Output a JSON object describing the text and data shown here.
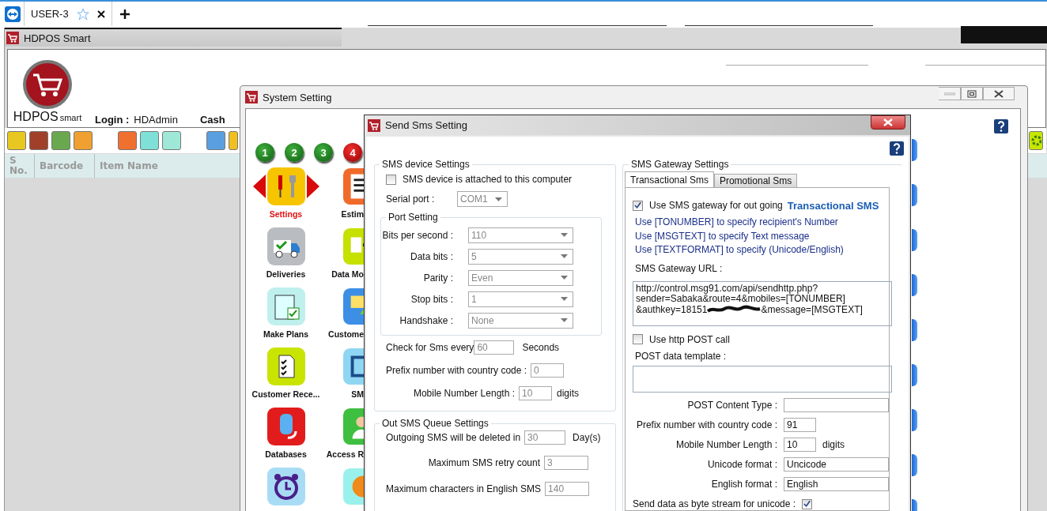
{
  "browser_tab": {
    "label": "USER-3"
  },
  "main_window": {
    "title": "HDPOS Smart",
    "logo_text": "HDPOS",
    "logo_subtext": "smart",
    "login_label": "Login :",
    "login_value": "HDAdmin",
    "cash_label": "Cash",
    "table_columns": [
      "S No.",
      "Barcode",
      "Item Name"
    ]
  },
  "system_setting": {
    "title": "System Setting",
    "pages": [
      {
        "label": "1",
        "selected": false
      },
      {
        "label": "2",
        "selected": false
      },
      {
        "label": "3",
        "selected": false
      },
      {
        "label": "4",
        "selected": true
      }
    ],
    "tiles": [
      {
        "label": "Settings",
        "selected": true
      },
      {
        "label": "Estim",
        "selected": false
      },
      {
        "label": "Deliveries",
        "selected": false
      },
      {
        "label": "Data Mo",
        "selected": false
      },
      {
        "label": "Make Plans",
        "selected": false
      },
      {
        "label": "Custome",
        "selected": false
      },
      {
        "label": "Customer Rece...",
        "selected": false
      },
      {
        "label": "SM",
        "selected": false
      },
      {
        "label": "Databases",
        "selected": false
      },
      {
        "label": "Access R",
        "selected": false
      },
      {
        "selected": false
      },
      {
        "selected": false
      }
    ]
  },
  "sms_dialog": {
    "title": "Send Sms Setting",
    "device": {
      "legend": "SMS device Settings",
      "attached": {
        "label": "SMS device is attached to this computer",
        "checked": false
      },
      "serial_port": {
        "label": "Serial port :",
        "value": "COM1",
        "disabled": true
      },
      "port_setting": {
        "legend": "Port Setting",
        "fields": [
          {
            "label": "Bits per second :",
            "value": "110",
            "disabled": true
          },
          {
            "label": "Data bits :",
            "value": "5",
            "disabled": true
          },
          {
            "label": "Parity :",
            "value": "Even",
            "disabled": true
          },
          {
            "label": "Stop bits :",
            "value": "1",
            "disabled": true
          },
          {
            "label": "Handshake :",
            "value": "None",
            "disabled": true
          }
        ]
      },
      "check_every": {
        "label": "Check for Sms every",
        "value": "60",
        "unit": "Seconds",
        "disabled": true
      },
      "prefix": {
        "label": "Prefix number with country code :",
        "value": "0",
        "disabled": true
      },
      "mobile_length": {
        "label": "Mobile Number Length :",
        "value": "10",
        "unit": "digits",
        "disabled": true
      }
    },
    "queue": {
      "legend": "Out SMS Queue Settings",
      "fields": [
        {
          "label": "Outgoing SMS will be deleted in",
          "value": "30",
          "unit": "Day(s)",
          "disabled": true
        },
        {
          "label": "Maximum SMS retry count",
          "value": "3",
          "disabled": true
        },
        {
          "label": "Maximum characters in English SMS",
          "value": "140",
          "disabled": true
        }
      ]
    },
    "gateway": {
      "legend": "SMS Gateway Settings",
      "tabs": [
        {
          "label": "Transactional Sms",
          "selected": true
        },
        {
          "label": "Promotional Sms",
          "selected": false
        }
      ],
      "use_gateway": {
        "label": "Use SMS gateway for out going",
        "emphasis": "Transactional SMS",
        "checked": true
      },
      "hints": [
        "Use [TONUMBER] to specify recipient's Number",
        "Use [MSGTEXT] to specify Text message",
        "Use [TEXTFORMAT] to specify (Unicode/English)"
      ],
      "url_label": "SMS Gateway URL :",
      "url_lines": [
        "http://control.msg91.com/api/sendhttp.php?",
        "sender=Sabaka&route=4&mobiles=[TONUMBER]",
        "&authkey=18151"
      ],
      "url_tail": "&message=[MSGTEXT]",
      "http_post": {
        "label": "Use http POST call",
        "checked": false
      },
      "post_template_label": "POST data template :",
      "fields": [
        {
          "kind": "wide",
          "label": "POST Content Type :"
        },
        {
          "kind": "short",
          "label": "Prefix number with country code :",
          "value": "91"
        },
        {
          "kind": "short",
          "label": "Mobile Number Length :",
          "value": "10",
          "unit": "digits"
        },
        {
          "kind": "wide",
          "label": "Unicode format :",
          "value": "Uncicode"
        },
        {
          "kind": "wide",
          "label": "English format :",
          "value": "English"
        },
        {
          "kind": "checkbox",
          "label": "Send data as byte stream for unicode :",
          "checked": true
        }
      ]
    }
  }
}
